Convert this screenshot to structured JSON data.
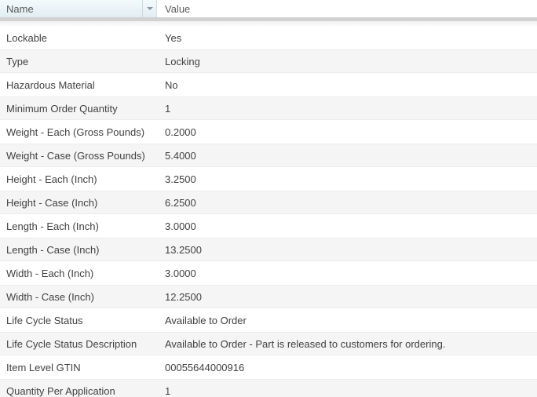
{
  "table": {
    "header": {
      "name_label": "Name",
      "value_label": "Value",
      "sort_icon": "chevron-down"
    },
    "rows": [
      {
        "name": "Lockable",
        "value": "Yes"
      },
      {
        "name": "Type",
        "value": "Locking"
      },
      {
        "name": "Hazardous Material",
        "value": "No"
      },
      {
        "name": "Minimum Order Quantity",
        "value": "1"
      },
      {
        "name": "Weight - Each (Gross Pounds)",
        "value": "0.2000"
      },
      {
        "name": "Weight - Case (Gross Pounds)",
        "value": "5.4000"
      },
      {
        "name": "Height - Each (Inch)",
        "value": "3.2500"
      },
      {
        "name": "Height - Case (Inch)",
        "value": "6.2500"
      },
      {
        "name": "Length - Each (Inch)",
        "value": "3.0000"
      },
      {
        "name": "Length - Case (Inch)",
        "value": "13.2500"
      },
      {
        "name": "Width - Each (Inch)",
        "value": "3.0000"
      },
      {
        "name": "Width - Case (Inch)",
        "value": "12.2500"
      },
      {
        "name": "Life Cycle Status",
        "value": "Available to Order"
      },
      {
        "name": "Life Cycle Status Description",
        "value": "Available to Order - Part is released to customers for ordering."
      },
      {
        "name": "Item Level GTIN",
        "value": "00055644000916"
      },
      {
        "name": "Quantity Per Application",
        "value": "1"
      }
    ]
  },
  "colors": {
    "header_hover_tint": "#e2eef3",
    "header_separator": "#d6dde0",
    "shadow_band_dark": "#d2d2d2",
    "alt_row_background": "#f5f5f5",
    "row_text": "#414141",
    "header_text": "#5a5a5a"
  }
}
